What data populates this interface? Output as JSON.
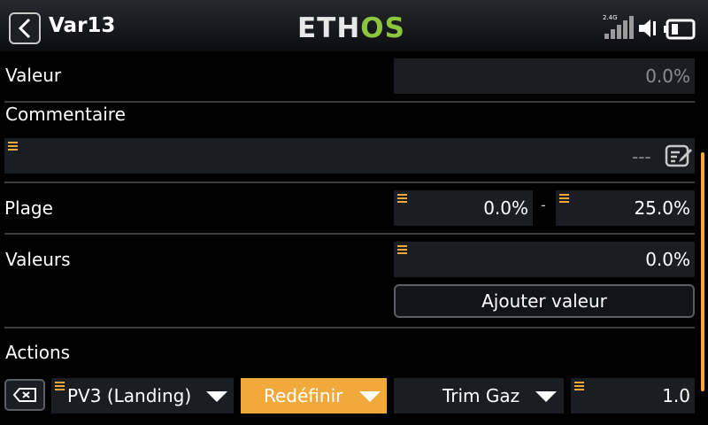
{
  "header": {
    "title": "Var13",
    "logo_eth": "ETH",
    "logo_os": "OS",
    "signal_label": "2.4G",
    "back_icon": "chevron-left-icon"
  },
  "rows": {
    "valeur_label": "Valeur",
    "valeur_value": "0.0%",
    "commentaire_label": "Commentaire",
    "commentaire_value": "---",
    "plage_label": "Plage",
    "plage_min": "0.0%",
    "plage_dash": "-",
    "plage_max": "25.0%",
    "valeurs_label": "Valeurs",
    "valeurs_value": "0.0%",
    "ajouter_label": "Ajouter valeur",
    "actions_label": "Actions"
  },
  "actions": {
    "source": "PV3 (Landing)",
    "mode": "Redéfinir",
    "target": "Trim Gaz",
    "amount": "1.0"
  },
  "colors": {
    "accent": "#f2a93b",
    "logo_green": "#8cc63f",
    "field_bg": "#1a1d21",
    "background": "#000000"
  }
}
